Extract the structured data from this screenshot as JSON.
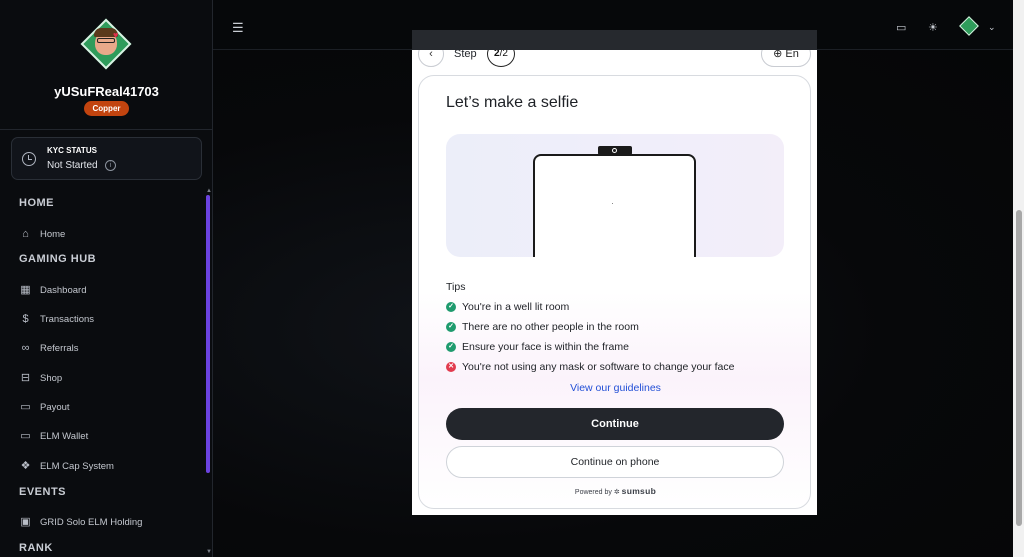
{
  "sidebar": {
    "username": "yUSuFReal41703",
    "rank_badge": "Copper",
    "kyc": {
      "title": "KYC STATUS",
      "value": "Not Started",
      "info": "i"
    },
    "sections": {
      "home": "HOME",
      "gaming_hub": "GAMING HUB",
      "events": "EVENTS",
      "rank": "RANK"
    },
    "items": [
      {
        "label": "Home",
        "icon": "home-icon"
      },
      {
        "label": "Dashboard",
        "icon": "dashboard-icon"
      },
      {
        "label": "Transactions",
        "icon": "dollar-icon"
      },
      {
        "label": "Referrals",
        "icon": "link-icon"
      },
      {
        "label": "Shop",
        "icon": "shop-icon"
      },
      {
        "label": "Payout",
        "icon": "wallet-icon"
      },
      {
        "label": "ELM Wallet",
        "icon": "wallet-icon"
      },
      {
        "label": "ELM Cap System",
        "icon": "cap-system-icon"
      },
      {
        "label": "GRID Solo ELM Holding",
        "icon": "calendar-icon"
      }
    ]
  },
  "topbar": {
    "menu_icon": "hamburger-icon",
    "icons": [
      "wallet-icon",
      "theme-sun-icon",
      "avatar",
      "chevron-down-icon"
    ]
  },
  "modal": {
    "step_label": "Step",
    "step_current": "2",
    "step_total": "2",
    "step_separator": "/",
    "language": "En",
    "title": "Let’s make a selfie",
    "tips_title": "Tips",
    "tips": [
      {
        "text": "You're in a well lit room",
        "status": "ok"
      },
      {
        "text": "There are no other people in the room",
        "status": "ok"
      },
      {
        "text": "Ensure your face is within the frame",
        "status": "ok"
      },
      {
        "text": "You're not using any mask or software to change your face",
        "status": "bad"
      }
    ],
    "guidelines_link": "View our guidelines",
    "continue_label": "Continue",
    "continue_phone_label": "Continue on phone",
    "powered_by": "Powered by",
    "brand": "sumsub"
  },
  "colors": {
    "accent": "#6b43e0",
    "badge": "#c2440f",
    "ok": "#1f9b6e",
    "bad": "#e23b4e",
    "link": "#2350d6",
    "primary_button": "#23262c"
  }
}
